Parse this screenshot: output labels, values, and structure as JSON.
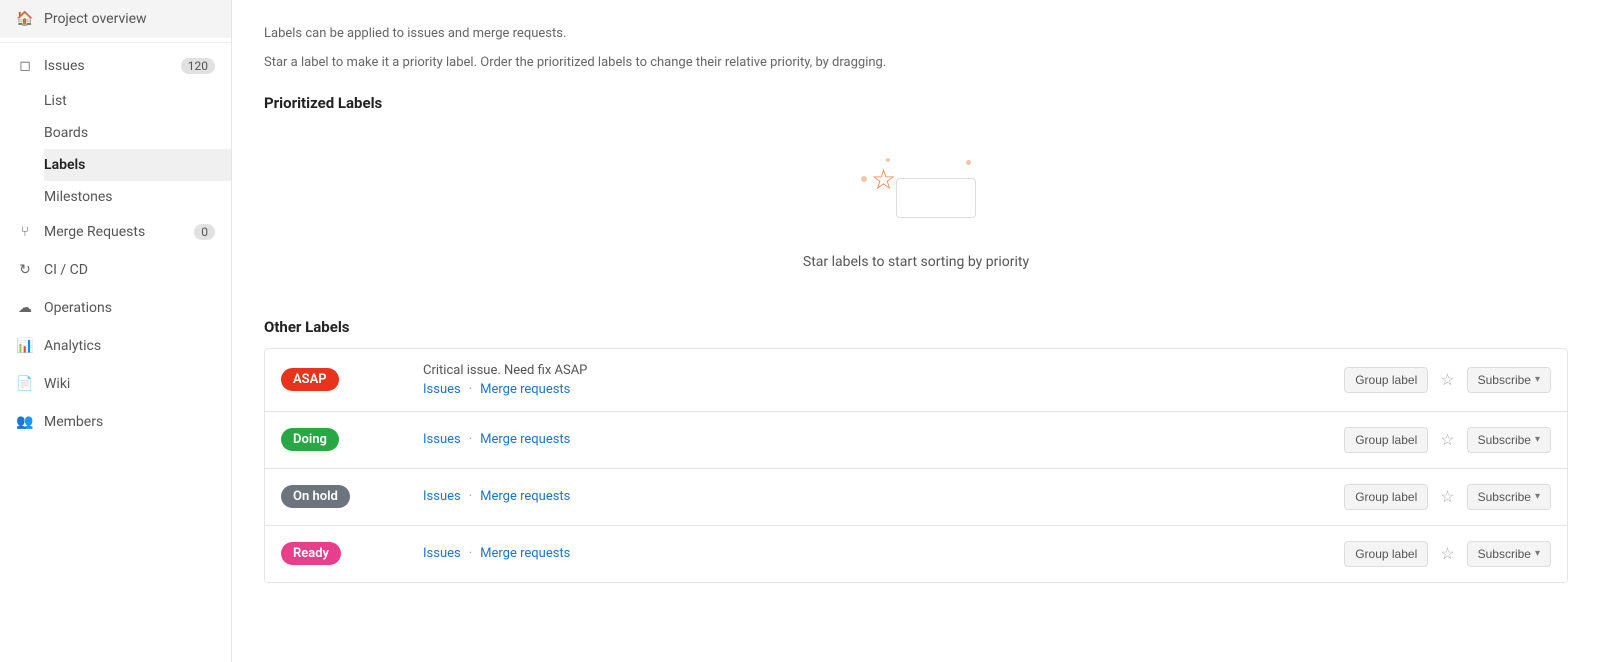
{
  "sidebar": {
    "project_overview": "Project overview",
    "issues_label": "Issues",
    "issues_count": "120",
    "list_label": "List",
    "boards_label": "Boards",
    "labels_label": "Labels",
    "milestones_label": "Milestones",
    "merge_requests_label": "Merge Requests",
    "merge_requests_count": "0",
    "cicd_label": "CI / CD",
    "operations_label": "Operations",
    "analytics_label": "Analytics",
    "wiki_label": "Wiki",
    "members_label": "Members"
  },
  "main": {
    "info_line1": "Labels can be applied to issues and merge requests.",
    "info_line2": "Star a label to make it a priority label. Order the prioritized labels to change their relative priority, by dragging.",
    "prioritized_title": "Prioritized Labels",
    "empty_state_text": "Star labels to start sorting by priority",
    "other_labels_title": "Other Labels",
    "labels": [
      {
        "id": "asap",
        "badge_text": "ASAP",
        "badge_class": "asap",
        "description": "Critical issue. Need fix ASAP",
        "issues_link": "Issues",
        "merge_requests_link": "Merge requests",
        "group_label": "Group label",
        "subscribe": "Subscribe"
      },
      {
        "id": "doing",
        "badge_text": "Doing",
        "badge_class": "doing",
        "description": "",
        "issues_link": "Issues",
        "merge_requests_link": "Merge requests",
        "group_label": "Group label",
        "subscribe": "Subscribe"
      },
      {
        "id": "on-hold",
        "badge_text": "On hold",
        "badge_class": "on-hold",
        "description": "",
        "issues_link": "Issues",
        "merge_requests_link": "Merge requests",
        "group_label": "Group label",
        "subscribe": "Subscribe"
      },
      {
        "id": "ready",
        "badge_text": "Ready",
        "badge_class": "ready",
        "description": "",
        "issues_link": "Issues",
        "merge_requests_link": "Merge requests",
        "group_label": "Group label",
        "subscribe": "Subscribe"
      }
    ]
  }
}
